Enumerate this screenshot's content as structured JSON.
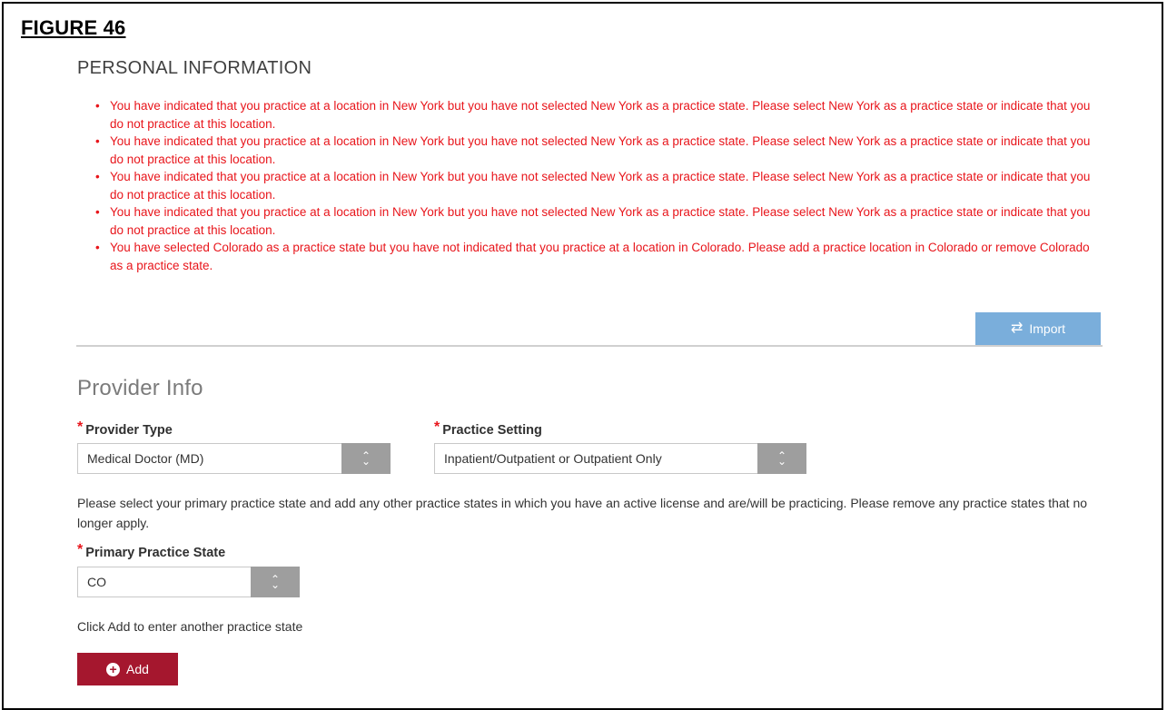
{
  "figure_label": "FIGURE 46",
  "section_title": "PERSONAL INFORMATION",
  "errors": [
    "You have indicated that you practice at a location in New York but you have not selected New York as a practice state. Please select New York as a practice state or indicate that you do not practice at this location.",
    "You have indicated that you practice at a location in New York but you have not selected New York as a practice state. Please select New York as a practice state or indicate that you do not practice at this location.",
    "You have indicated that you practice at a location in New York but you have not selected New York as a practice state. Please select New York as a practice state or indicate that you do not practice at this location.",
    "You have indicated that you practice at a location in New York but you have not selected New York as a practice state. Please select New York as a practice state or indicate that you do not practice at this location.",
    "You have selected Colorado as a practice state but you have not indicated that you practice at a location in Colorado. Please add a practice location in Colorado or remove Colorado as a practice state."
  ],
  "import_button": {
    "label": "Import",
    "icon": "swap-arrows-icon",
    "color": "#7aaedb"
  },
  "provider_info_title": "Provider Info",
  "required_marker": "*",
  "provider_type": {
    "label": "Provider Type",
    "value": "Medical Doctor (MD)"
  },
  "practice_setting": {
    "label": "Practice Setting",
    "value": "Inpatient/Outpatient or Outpatient Only"
  },
  "practice_state_help": "Please select your primary practice state and add any other practice states in which you have an active license and are/will be practicing. Please remove any practice states that no longer apply.",
  "primary_practice_state": {
    "label": "Primary Practice State",
    "value": "CO"
  },
  "add_help": "Click Add to enter another practice state",
  "add_button": {
    "label": "Add",
    "icon": "plus-circle-icon",
    "color": "#a5172e"
  },
  "colors": {
    "error": "#e8151b",
    "select_arrow_bg": "#9e9e9e"
  }
}
